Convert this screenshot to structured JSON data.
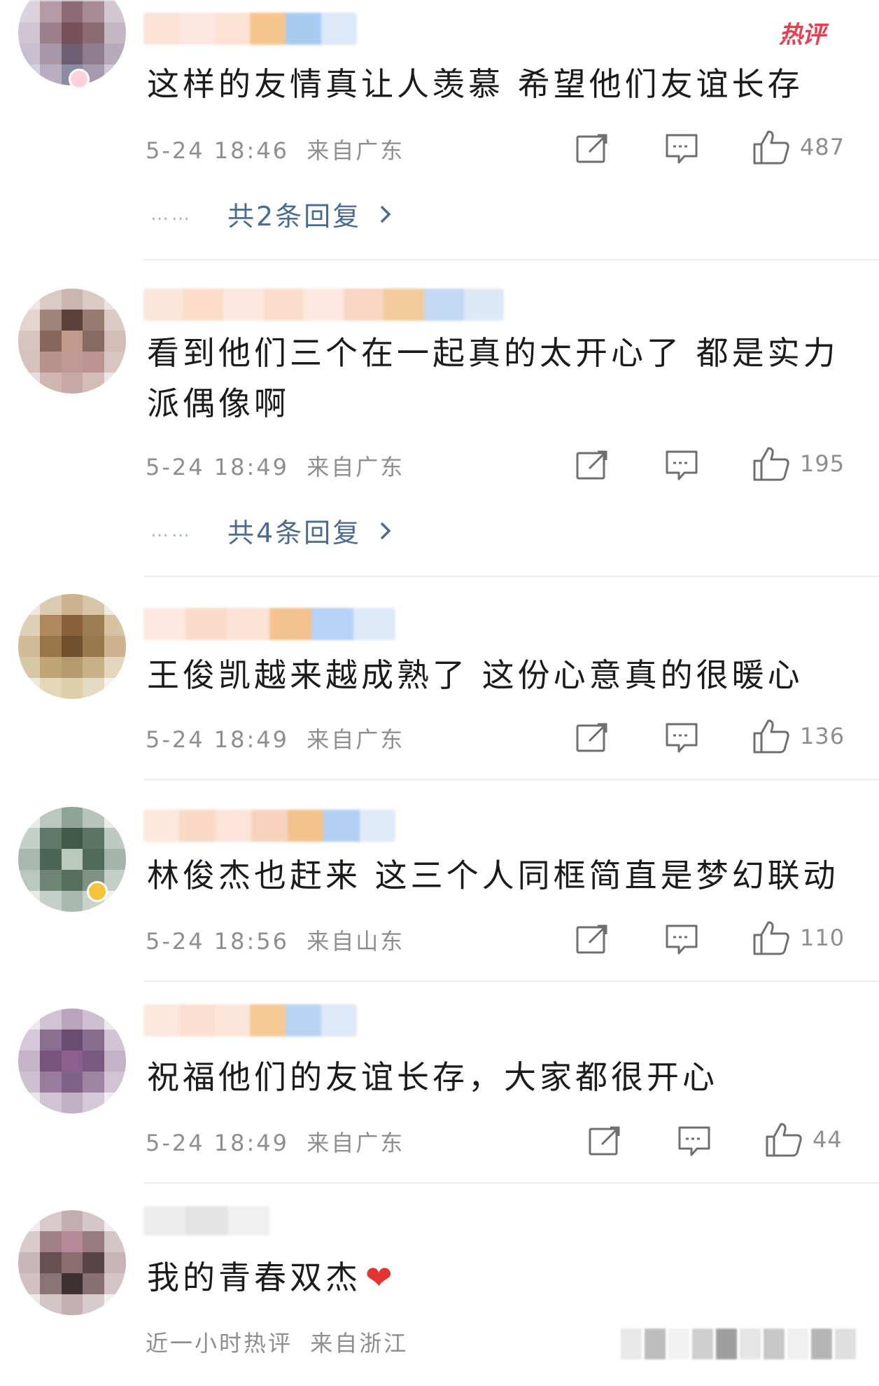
{
  "badge": {
    "hot": "热评"
  },
  "comments": [
    {
      "text": "这样的友情真让人羡慕  希望他们友谊长存",
      "time": "5-24 18:46",
      "location": "来自广东",
      "likes": "487",
      "replies": "共2条回复"
    },
    {
      "text": "看到他们三个在一起真的太开心了  都是实力派偶像啊",
      "time": "5-24 18:49",
      "location": "来自广东",
      "likes": "195",
      "replies": "共4条回复"
    },
    {
      "text": "王俊凯越来越成熟了  这份心意真的很暖心",
      "time": "5-24 18:49",
      "location": "来自广东",
      "likes": "136"
    },
    {
      "text": "林俊杰也赶来  这三个人同框简直是梦幻联动",
      "time": "5-24 18:56",
      "location": "来自山东",
      "likes": "110"
    },
    {
      "text": "祝福他们的友谊长存，大家都很开心",
      "time": "5-24 18:49",
      "location": "来自广东",
      "likes": "44"
    },
    {
      "text": "我的青春双杰",
      "heart": "❤",
      "time": "近一小时热评",
      "location": "来自浙江"
    }
  ],
  "reply_dots": "……",
  "icons": {
    "share": "share-icon",
    "comment": "comment-icon",
    "like": "thumbs-up-icon",
    "chevron": "chevron-right-icon"
  },
  "colors": {
    "reply_link": "#4b6b91",
    "meta": "#8e8e8e",
    "hot_badge": "#e64050",
    "heart": "#e33333"
  }
}
